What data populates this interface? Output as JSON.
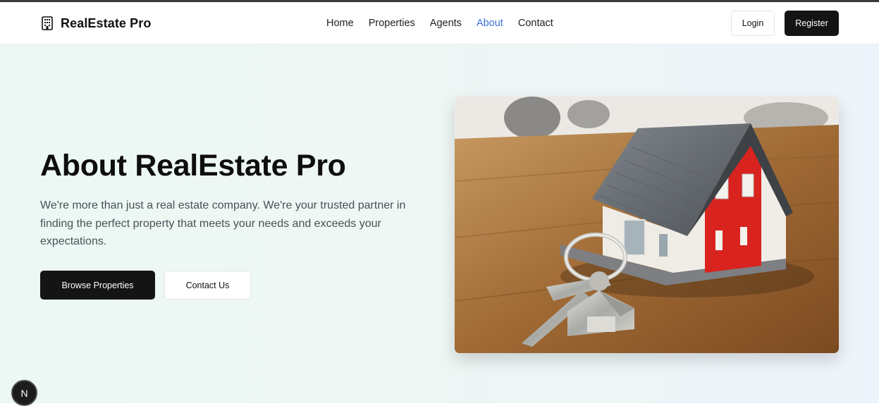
{
  "header": {
    "brand": "RealEstate Pro",
    "brand_icon": "building-icon",
    "nav": [
      {
        "label": "Home",
        "active": false
      },
      {
        "label": "Properties",
        "active": false
      },
      {
        "label": "Agents",
        "active": false
      },
      {
        "label": "About",
        "active": true
      },
      {
        "label": "Contact",
        "active": false
      }
    ],
    "login_label": "Login",
    "register_label": "Register"
  },
  "hero": {
    "title": "About RealEstate Pro",
    "description": "We're more than just a real estate company. We're your trusted partner in finding the perfect property that meets your needs and exceeds your expectations.",
    "primary_button": "Browse Properties",
    "secondary_button": "Contact Us"
  },
  "dev_badge": "N",
  "colors": {
    "accent": "#3b73d6",
    "dark_button": "#141414",
    "hero_bg_start": "#ecf8f3",
    "hero_bg_end": "#eef4fb"
  }
}
